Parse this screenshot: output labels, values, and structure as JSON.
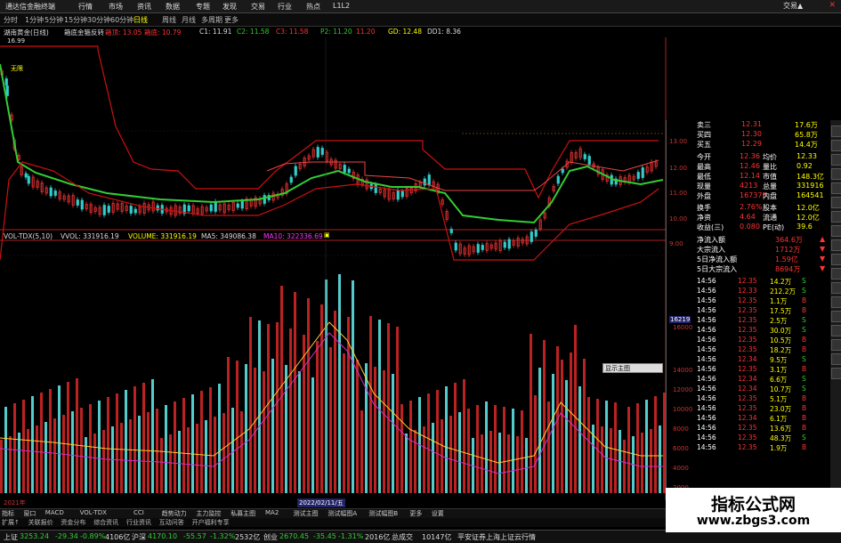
{
  "app": {
    "title": "通达信金融终端",
    "menu": [
      "行情",
      "市场",
      "资讯",
      "数据",
      "专题",
      "发现",
      "交易",
      "行业",
      "热点",
      "L1L2"
    ],
    "trade_label": "交易▲"
  },
  "periods": [
    "分时",
    "1分钟",
    "5分钟",
    "15分钟",
    "30分钟",
    "60分钟",
    "日线",
    "周线",
    "月线",
    "多周期",
    "更多"
  ],
  "active_period": "日线",
  "main_info": {
    "stock": "湖南黄金(日线)",
    "indicator": "箱底金箍反转",
    "items": [
      {
        "text": "箱顶: 13.05",
        "color": "#f33"
      },
      {
        "text": "箱底: 10.79",
        "color": "#f33"
      },
      {
        "text": "C1: 11.91",
        "color": "#ddd"
      },
      {
        "text": "C2: 11.58",
        "color": "#3c3"
      },
      {
        "text": "C3: 11.58",
        "color": "#f33"
      },
      {
        "text": "P2: 11.20",
        "color": "#3c3"
      },
      {
        "text": "11.20",
        "color": "#f33"
      },
      {
        "text": "GD: 12.48",
        "color": "#ff0"
      },
      {
        "text": "DD1: 8.36",
        "color": "#ddd"
      }
    ],
    "high_label": "16.99",
    "annotation": "无限"
  },
  "vol_info": {
    "items": [
      {
        "text": "VOL-TDX(5,10)",
        "color": "#ddd"
      },
      {
        "text": "VVOL: 331916.19",
        "color": "#ddd"
      },
      {
        "text": "VOLUME: 331916.19",
        "color": "#ff0"
      },
      {
        "text": "MA5: 349086.38",
        "color": "#ddd"
      },
      {
        "text": "MA10: 322336.69",
        "color": "#f3f"
      }
    ]
  },
  "y_axis_price": [
    "13.00",
    "12.00",
    "11.00",
    "10.00",
    "9.00"
  ],
  "y_axis_volume": [
    "16000",
    "14000",
    "12000",
    "10000",
    "8000",
    "6000",
    "4000",
    "2000"
  ],
  "vol_last_label": "16219",
  "popup": "显示主图",
  "date_labels": {
    "left": "2021年",
    "cursor": "2022/02/11/五"
  },
  "quote": {
    "asks": [
      {
        "label": "卖三",
        "price": "12.31",
        "vol": "17.6万"
      },
      {
        "label": "买四",
        "price": "12.30",
        "vol": "65.8万"
      },
      {
        "label": "买五",
        "price": "12.29",
        "vol": "14.4万"
      }
    ],
    "stats": [
      {
        "l1": "今开",
        "v1": "12.36",
        "l2": "均价",
        "v2": "12.33"
      },
      {
        "l1": "最高",
        "v1": "12.46",
        "l2": "量比",
        "v2": "0.92"
      },
      {
        "l1": "最低",
        "v1": "12.14",
        "l2": "市值",
        "v2": "148.3亿"
      },
      {
        "l1": "现量",
        "v1": "4213",
        "l2": "总量",
        "v2": "331916"
      },
      {
        "l1": "外盘",
        "v1": "167375",
        "l2": "内盘",
        "v2": "164541"
      }
    ],
    "stats2": [
      {
        "l1": "换手",
        "v1": "2.76%",
        "l2": "股本",
        "v2": "12.0亿"
      },
      {
        "l1": "净资",
        "v1": "4.64",
        "l2": "流通",
        "v2": "12.0亿"
      },
      {
        "l1": "收益(三)",
        "v1": "0.080",
        "l2": "PE(动)",
        "v2": "39.6"
      }
    ],
    "flows": [
      {
        "label": "净流入额",
        "value": "364.6万",
        "mark": "▲"
      },
      {
        "label": "大宗流入",
        "value": "1712万",
        "mark": "▼"
      },
      {
        "label": "5日净流入额",
        "value": "1.59亿",
        "mark": "▼"
      },
      {
        "label": "5日大宗流入",
        "value": "8694万",
        "mark": "▼"
      }
    ],
    "ticks": [
      {
        "t": "14:56",
        "p": "12.35",
        "v": "14.2万",
        "s": "S"
      },
      {
        "t": "14:56",
        "p": "12.33",
        "v": "212.2万",
        "s": "S"
      },
      {
        "t": "14:56",
        "p": "12.35",
        "v": "1.1万",
        "s": "B"
      },
      {
        "t": "14:56",
        "p": "12.35",
        "v": "17.5万",
        "s": "B"
      },
      {
        "t": "14:56",
        "p": "12.35",
        "v": "2.5万",
        "s": "S"
      },
      {
        "t": "14:56",
        "p": "12.35",
        "v": "30.0万",
        "s": "S"
      },
      {
        "t": "14:56",
        "p": "12.35",
        "v": "10.5万",
        "s": "B"
      },
      {
        "t": "14:56",
        "p": "12.35",
        "v": "18.2万",
        "s": "B"
      },
      {
        "t": "14:56",
        "p": "12.34",
        "v": "9.5万",
        "s": "S"
      },
      {
        "t": "14:56",
        "p": "12.35",
        "v": "3.1万",
        "s": "B"
      },
      {
        "t": "14:56",
        "p": "12.34",
        "v": "6.6万",
        "s": "S"
      },
      {
        "t": "14:56",
        "p": "12.34",
        "v": "10.7万",
        "s": "S"
      },
      {
        "t": "14:56",
        "p": "12.35",
        "v": "5.1万",
        "s": "B"
      },
      {
        "t": "14:56",
        "p": "12.35",
        "v": "23.0万",
        "s": "B"
      },
      {
        "t": "14:56",
        "p": "12.34",
        "v": "6.1万",
        "s": "B"
      },
      {
        "t": "14:56",
        "p": "12.35",
        "v": "13.6万",
        "s": "B"
      },
      {
        "t": "14:56",
        "p": "12.35",
        "v": "48.3万",
        "s": "S"
      },
      {
        "t": "14:56",
        "p": "12.35",
        "v": "1.9万",
        "s": "B"
      }
    ]
  },
  "indicator_tabs": [
    "指标",
    "窗口",
    "MACD",
    "VOL-TDX",
    "CCI",
    "趋势动力",
    "主力监控",
    "私募主图",
    "MA2",
    "测试主图",
    "测试幅图A",
    "测试幅图B",
    "更多",
    "设置"
  ],
  "func_tabs": [
    "扩展↑",
    "关联报价",
    "资金分布",
    "综合资讯",
    "行业资讯",
    "互动问答",
    "开户福利专享"
  ],
  "status": [
    {
      "text": "上证",
      "color": "#ddd"
    },
    {
      "text": "3253.24",
      "color": "#3c3"
    },
    {
      "text": "-29.34",
      "color": "#3c3"
    },
    {
      "text": "-0.89%",
      "color": "#3c3"
    },
    {
      "text": "4106亿",
      "color": "#ddd"
    },
    {
      "text": "沪深",
      "color": "#ddd"
    },
    {
      "text": "4170.10",
      "color": "#3c3"
    },
    {
      "text": "-55.57",
      "color": "#3c3"
    },
    {
      "text": "-1.32%",
      "color": "#3c3"
    },
    {
      "text": "2532亿",
      "color": "#ddd"
    },
    {
      "text": "创业",
      "color": "#ddd"
    },
    {
      "text": "2670.45",
      "color": "#3c3"
    },
    {
      "text": "-35.45",
      "color": "#3c3"
    },
    {
      "text": "-1.31%",
      "color": "#3c3"
    },
    {
      "text": "2016亿",
      "color": "#ddd"
    },
    {
      "text": "总成交",
      "color": "#ddd"
    },
    {
      "text": "10147亿",
      "color": "#ddd"
    },
    {
      "text": "平安证券上海上证云行情",
      "color": "#ddd"
    }
  ],
  "watermark": {
    "title": "指标公式网",
    "url": "www.zbgs3.com"
  },
  "colors": {
    "up": "#e33",
    "down": "#3cc",
    "ma_green": "#3c3",
    "box": "#c11"
  }
}
